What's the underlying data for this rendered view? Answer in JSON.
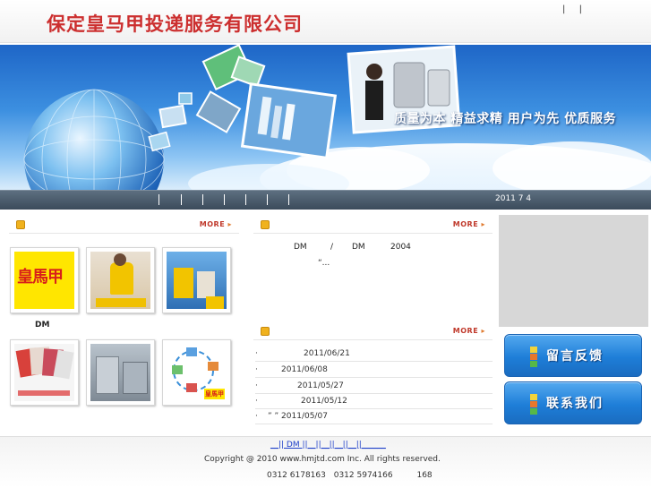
{
  "header": {
    "company_name": "保定皇马甲投递服务有限公司",
    "top_links": [
      "|",
      "|"
    ]
  },
  "banner": {
    "slogan": "质量为本 精益求精 用户为先 优质服务"
  },
  "nav": {
    "separators": [
      "|",
      "|",
      "|",
      "|",
      "|",
      "|",
      "|"
    ],
    "date_text": "2011 7 4"
  },
  "sections": {
    "products": {
      "more_label": "MORE"
    },
    "about": {
      "more_label": "MORE",
      "line_parts": [
        "DM",
        "/",
        "DM",
        "2004"
      ],
      "quote": "“..."
    },
    "news": {
      "more_label": "MORE",
      "items": [
        {
          "bullet": "·",
          "date": "2011/06/21"
        },
        {
          "bullet": "·",
          "date": "2011/06/08"
        },
        {
          "bullet": "·",
          "date": "2011/05/27"
        },
        {
          "bullet": "·",
          "date": "2011/05/12"
        },
        {
          "bullet": "·",
          "date": "”  ” 2011/05/07"
        }
      ]
    }
  },
  "products": {
    "dm_label": "DM",
    "thumb_captions": [
      "皇馬甲",
      "",
      "",
      "",
      "",
      "皇馬甲"
    ]
  },
  "right": {
    "feedback_label": "留言反馈",
    "contact_label": "联系我们"
  },
  "footer": {
    "links": "__|| DM ||__||__||__||__||______",
    "copyright": "Copyright @ 2010 www.hmjtd.com Inc. All rights reserved.",
    "phones": [
      "0312 6178163",
      "0312 5974166",
      "168"
    ]
  },
  "colors": {
    "brand_red": "#cc2f2f",
    "nav_bg": "#4a5a6a",
    "button_blue": "#1e7ed8",
    "more_red": "#c0392b"
  }
}
